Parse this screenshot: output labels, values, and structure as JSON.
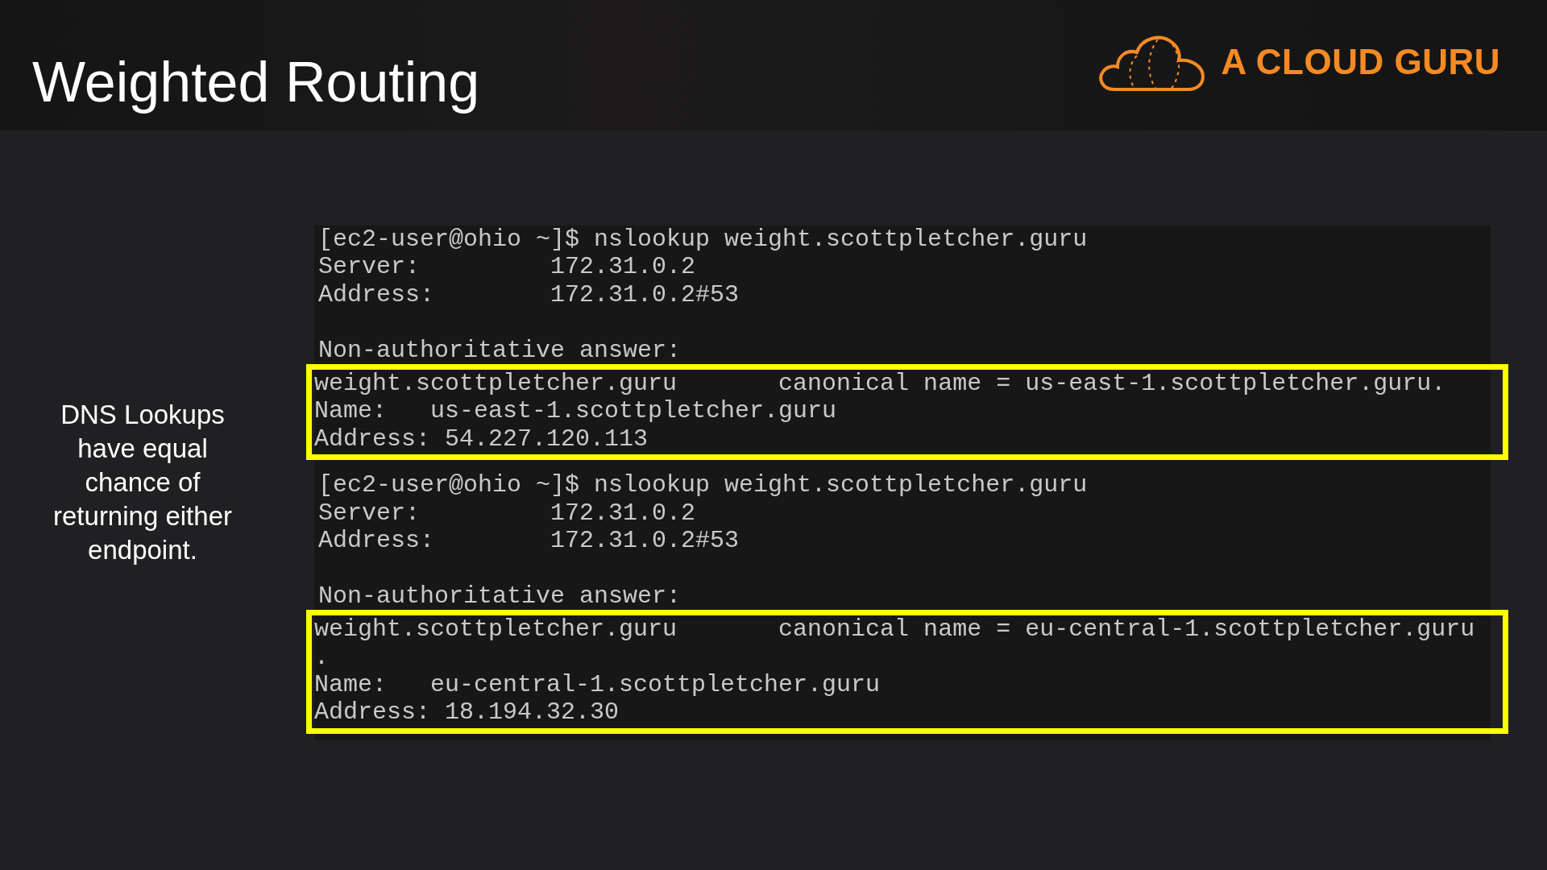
{
  "header": {
    "title": "Weighted Routing",
    "logo_text": "A CLOUD GURU"
  },
  "side_note": "DNS Lookups have equal chance of returning either endpoint.",
  "terminal": {
    "sessions": [
      {
        "command": "[ec2-user@ohio ~]$ nslookup weight.scottpletcher.guru",
        "server": "Server:         172.31.0.2",
        "address": "Address:        172.31.0.2#53",
        "answer_header": "Non-authoritative answer:",
        "highlighted": true,
        "answer_lines": [
          "weight.scottpletcher.guru       canonical name = us-east-1.scottpletcher.guru.",
          "Name:   us-east-1.scottpletcher.guru",
          "Address: 54.227.120.113"
        ]
      },
      {
        "command": "[ec2-user@ohio ~]$ nslookup weight.scottpletcher.guru",
        "server": "Server:         172.31.0.2",
        "address": "Address:        172.31.0.2#53",
        "answer_header": "Non-authoritative answer:",
        "highlighted": true,
        "answer_lines": [
          "weight.scottpletcher.guru       canonical name = eu-central-1.scottpletcher.guru",
          ".",
          "Name:   eu-central-1.scottpletcher.guru",
          "Address: 18.194.32.30"
        ]
      }
    ]
  }
}
